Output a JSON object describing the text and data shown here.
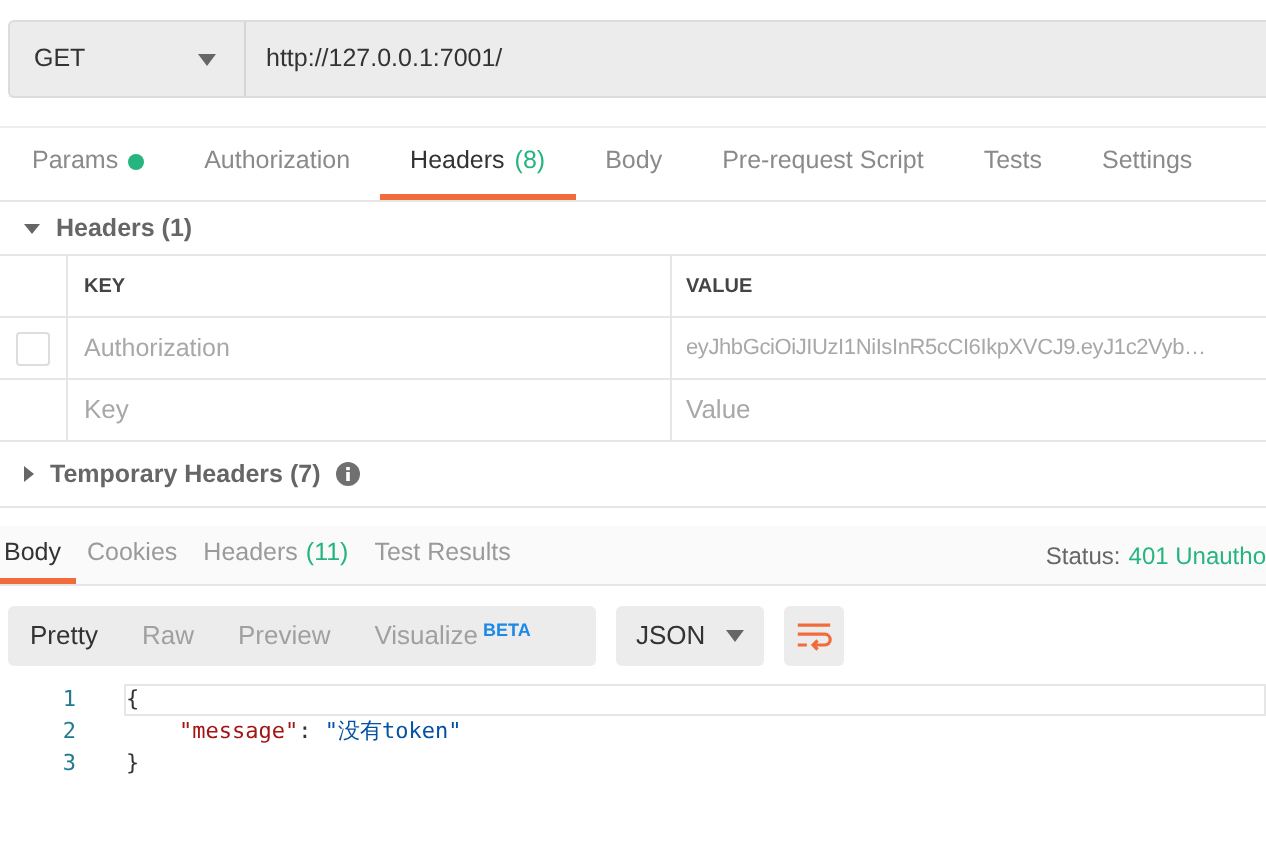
{
  "request": {
    "method": "GET",
    "url": "http://127.0.0.1:7001/"
  },
  "request_tabs": [
    {
      "label": "Params",
      "dot": true,
      "selected": false
    },
    {
      "label": "Authorization",
      "dot": false,
      "selected": false
    },
    {
      "label": "Headers",
      "count": "(8)",
      "dot": false,
      "selected": true
    },
    {
      "label": "Body",
      "dot": false,
      "selected": false
    },
    {
      "label": "Pre-request Script",
      "dot": false,
      "selected": false
    },
    {
      "label": "Tests",
      "dot": false,
      "selected": false
    },
    {
      "label": "Settings",
      "dot": false,
      "selected": false
    }
  ],
  "headers_section": {
    "title": "Headers",
    "count": "(1)",
    "expanded": true,
    "columns": [
      "KEY",
      "VALUE"
    ],
    "rows": [
      {
        "key": "Authorization",
        "value": "eyJhbGciOiJIUzI1NiIsInR5cCI6IkpXVCJ9.eyJ1c2Vyb…",
        "checked": false
      }
    ],
    "new_row": {
      "key_placeholder": "Key",
      "value_placeholder": "Value"
    }
  },
  "temporary_headers": {
    "title": "Temporary Headers",
    "count": "(7)",
    "expanded": false
  },
  "response_tabs": [
    {
      "label": "Body",
      "selected": true
    },
    {
      "label": "Cookies",
      "selected": false
    },
    {
      "label": "Headers",
      "count": "(11)",
      "selected": false
    },
    {
      "label": "Test Results",
      "selected": false
    }
  ],
  "status": {
    "label": "Status:",
    "value": "401 Unautho"
  },
  "view_modes": [
    {
      "label": "Pretty",
      "selected": true
    },
    {
      "label": "Raw",
      "selected": false
    },
    {
      "label": "Preview",
      "selected": false
    },
    {
      "label": "Visualize",
      "badge": "BETA",
      "selected": false
    }
  ],
  "format": "JSON",
  "code_lines": [
    {
      "number": "1",
      "highlighted": true,
      "tokens": [
        {
          "kind": "punct",
          "text": "{"
        }
      ]
    },
    {
      "number": "2",
      "highlighted": false,
      "tokens": [
        {
          "kind": "key",
          "text": "\"message\""
        },
        {
          "kind": "punct",
          "text": ": "
        },
        {
          "kind": "string",
          "text": "\"没有token\""
        }
      ]
    },
    {
      "number": "3",
      "highlighted": false,
      "tokens": [
        {
          "kind": "punct",
          "text": "}"
        }
      ]
    }
  ]
}
